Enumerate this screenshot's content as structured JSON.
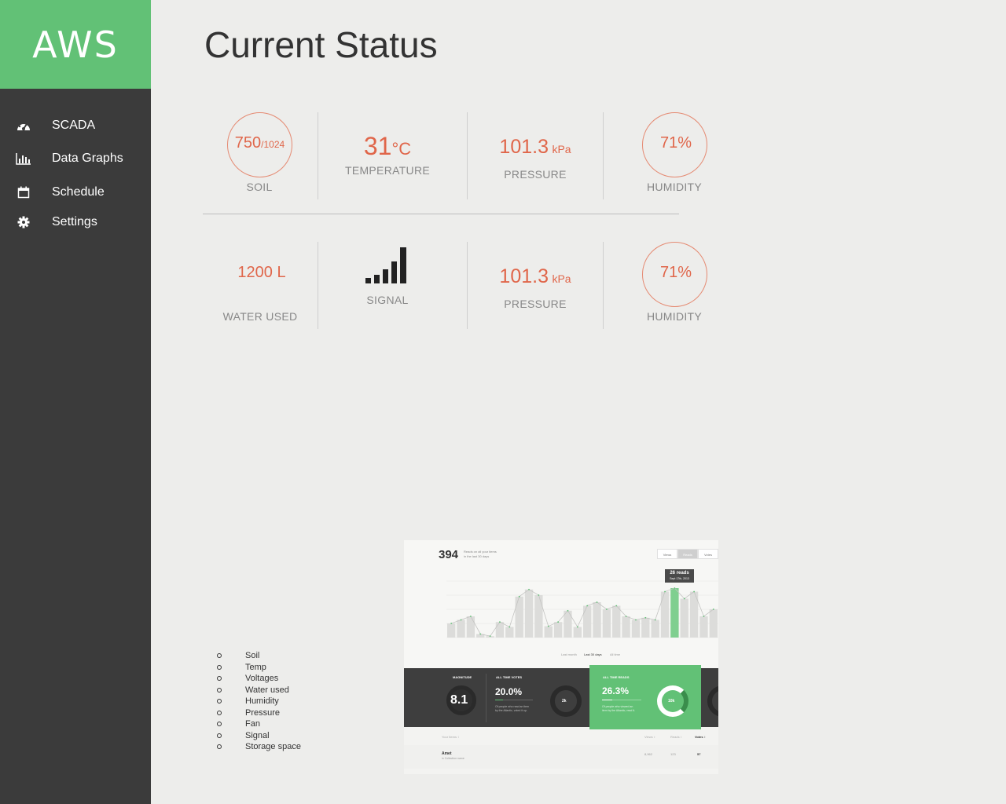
{
  "brand": {
    "name": "AWS",
    "color": "#62c176"
  },
  "nav": [
    {
      "label": "SCADA",
      "icon": "dashboard-icon"
    },
    {
      "label": "Data Graphs",
      "icon": "bar-chart-icon"
    },
    {
      "label": "Schedule",
      "icon": "calendar-icon"
    },
    {
      "label": "Settings",
      "icon": "gear-icon"
    }
  ],
  "page": {
    "title": "Current Status"
  },
  "colors": {
    "accent": "#e0664a",
    "sidebar": "#3b3b3b"
  },
  "row1": {
    "soil": {
      "value": "750",
      "max": "/1024",
      "label": "SOIL",
      "level": 0.73
    },
    "temperature": {
      "value": "31",
      "unit": "°C",
      "label": "TEMPERATURE"
    },
    "pressure": {
      "value": "101.3",
      "unit": "kPa",
      "label": "PRESSURE"
    },
    "humidity": {
      "value": "71%",
      "label": "HUMIDITY",
      "level": 0.71
    }
  },
  "row2": {
    "water": {
      "value": "1200 L",
      "label": "WATER USED"
    },
    "signal": {
      "label": "SIGNAL",
      "bars": 5,
      "icon": "signal-strength-icon"
    },
    "pressure": {
      "value": "101.3",
      "unit": "kPa",
      "label": "PRESSURE"
    },
    "humidity": {
      "value": "71%",
      "label": "HUMIDITY",
      "level": 0.71
    }
  },
  "legend": [
    "Soil",
    "Temp",
    "Voltages",
    "Water used",
    "Humidity",
    "Pressure",
    "Fan",
    "Signal",
    "Storage space"
  ],
  "mockup": {
    "headline": "394",
    "headline_sub1": "Reads on all your items",
    "headline_sub2": "in the last 30 days",
    "toggles": [
      "Views",
      "Reads",
      "Votes"
    ],
    "tooltip_value": "26 reads",
    "tooltip_date": "Sept 17th, 2013",
    "ranges": [
      "Last month",
      "Last 30 days",
      "All time"
    ],
    "stats": [
      {
        "head": "MAGNITUDE",
        "value": "8.1"
      },
      {
        "head": "ALL TIME VOTES",
        "value": "20.0%",
        "donut": "2k",
        "sub1": "Of people who read an item",
        "sub2": "by the Atlantic, voted it up."
      },
      {
        "head": "ALL TIME READS",
        "value": "26.3%",
        "donut": "10k",
        "sub1": "Of people who viewed an",
        "sub2": "item by the Atlantic, read it."
      }
    ],
    "table": {
      "headers": [
        "Your Items ↕",
        "Views ↕",
        "Reads ↕",
        "Votes ↕"
      ],
      "row": {
        "name": "Amet",
        "sub": "in Collection name",
        "views": "8,962",
        "reads": "123",
        "votes": "57"
      }
    },
    "chart_values": [
      20,
      25,
      30,
      5,
      2,
      22,
      15,
      58,
      68,
      60,
      16,
      22,
      38,
      15,
      45,
      50,
      40,
      45,
      30,
      25,
      28,
      25,
      65,
      70,
      55,
      65,
      30,
      40
    ]
  }
}
